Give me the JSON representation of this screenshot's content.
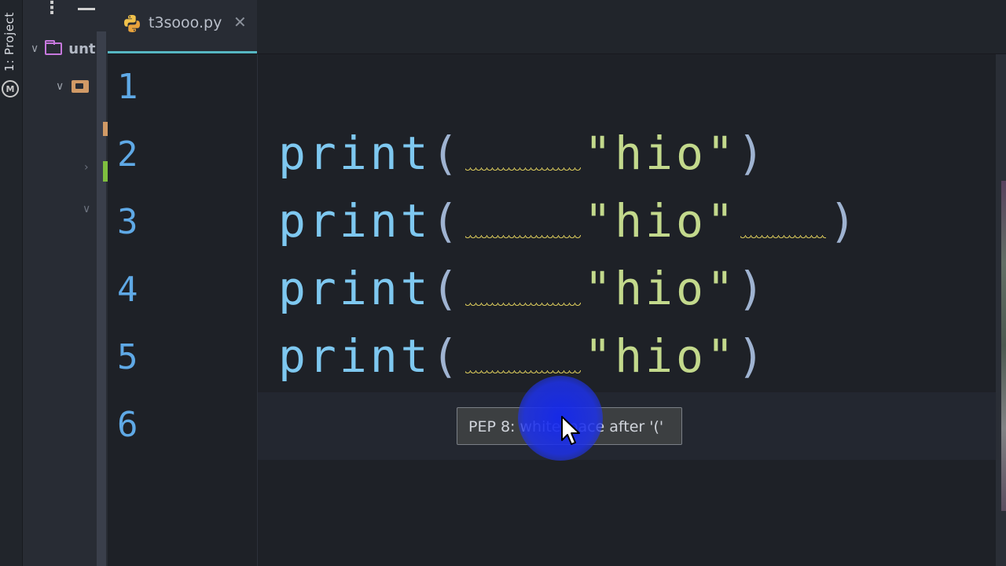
{
  "sidebar": {
    "tool_window_label": "1: Project",
    "tree_root_name": "unt"
  },
  "tab": {
    "file_name": "t3sooo.py",
    "close_glyph": "✕"
  },
  "editor": {
    "line_numbers": [
      "1",
      "2",
      "3",
      "4",
      "5",
      "6"
    ],
    "lines": [
      {
        "keyword": "print",
        "open": "(",
        "pad_before": "    ",
        "string": "\"hio\"",
        "pad_after": "",
        "close": ")"
      },
      {
        "keyword": "print",
        "open": "(",
        "pad_before": "    ",
        "string": "\"hio\"",
        "pad_after": "   ",
        "close": ")"
      },
      {
        "keyword": "print",
        "open": "(",
        "pad_before": "    ",
        "string": "\"hio\"",
        "pad_after": "",
        "close": ")"
      },
      {
        "keyword": "print",
        "open": "(",
        "pad_before": "    ",
        "string": "\"hio\"",
        "pad_after": "",
        "close": ")"
      }
    ]
  },
  "tooltip": {
    "text": "PEP 8: whitespace after '('"
  },
  "colors": {
    "keyword": "#7ec8f0",
    "string": "#c3d98c",
    "line_number": "#5fa9e6",
    "warning_squiggle": "#d6c65a",
    "cursor_highlight": "#1e32eb"
  }
}
